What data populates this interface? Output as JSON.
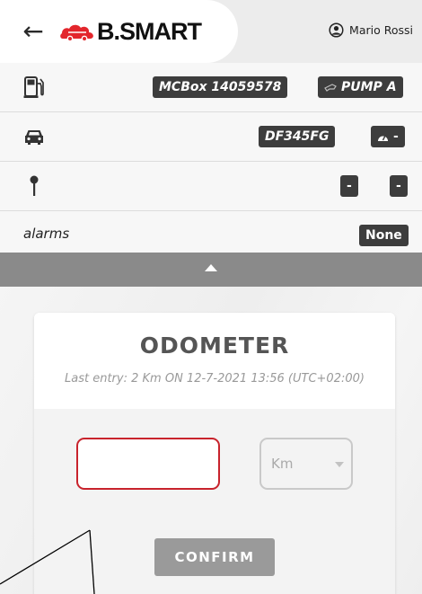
{
  "header": {
    "back_icon": "arrow-left-icon",
    "logo_text": "B.SMART",
    "brand_color": "#e3262c",
    "user_icon": "user-circle-icon",
    "user_name": "Mario Rossi"
  },
  "rows": [
    {
      "icon": "fuel-pump-icon",
      "chips": [
        {
          "text": "MCBox 14059578"
        },
        {
          "icon": "nozzle-icon",
          "text": "PUMP A"
        }
      ]
    },
    {
      "icon": "car-icon",
      "chips": [
        {
          "text": "DF345FG"
        },
        {
          "icon": "gauge-icon",
          "text": "-"
        }
      ]
    },
    {
      "icon": "location-pin-icon",
      "chips": [
        {
          "text": "-"
        },
        {
          "text": "-"
        }
      ]
    },
    {
      "label": "alarms",
      "chips": [
        {
          "text": "None"
        }
      ]
    }
  ],
  "collapse": {
    "icon": "caret-up-icon"
  },
  "odometer": {
    "title": "ODOMETER",
    "last_entry": "Last entry: 2 Km ON 12-7-2021 13:56 (UTC+02:00)",
    "input_value": "",
    "unit_selected": "Km",
    "confirm_label": "CONFIRM",
    "input_border_color": "#c8232c"
  }
}
